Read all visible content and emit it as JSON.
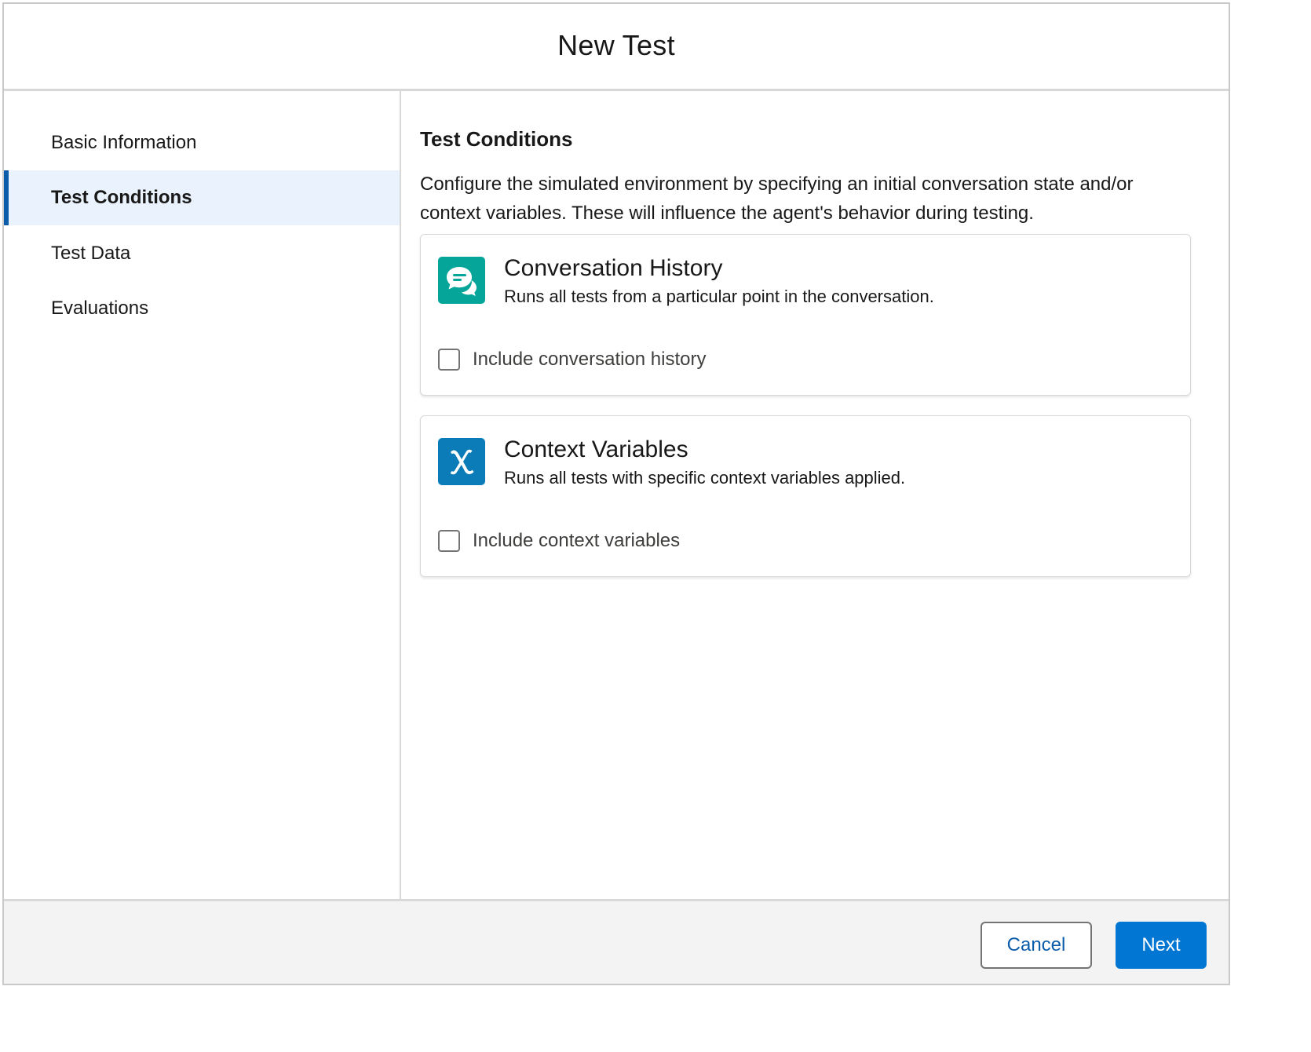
{
  "modal": {
    "title": "New Test"
  },
  "sidebar": {
    "items": [
      {
        "label": "Basic Information",
        "active": false
      },
      {
        "label": "Test Conditions",
        "active": true
      },
      {
        "label": "Test Data",
        "active": false
      },
      {
        "label": "Evaluations",
        "active": false
      }
    ]
  },
  "main": {
    "section_title": "Test Conditions",
    "description": "Configure the simulated environment by specifying an initial conversation state and/or context variables. These will influence the agent's behavior during testing.",
    "cards": [
      {
        "icon": "chat-bubbles-icon",
        "icon_color": "#06a59a",
        "title": "Conversation History",
        "subtitle": "Runs all tests from a particular point in the conversation.",
        "checkbox_label": "Include conversation history",
        "checked": false
      },
      {
        "icon": "variable-x-icon",
        "icon_color": "#0b7cb8",
        "title": "Context Variables",
        "subtitle": "Runs all tests with specific context variables applied.",
        "checkbox_label": "Include context variables",
        "checked": false
      }
    ]
  },
  "footer": {
    "cancel_label": "Cancel",
    "next_label": "Next"
  },
  "colors": {
    "brand": "#0176d3",
    "active_nav_bg": "#eaf3fd",
    "active_nav_bar": "#0b5cab"
  }
}
